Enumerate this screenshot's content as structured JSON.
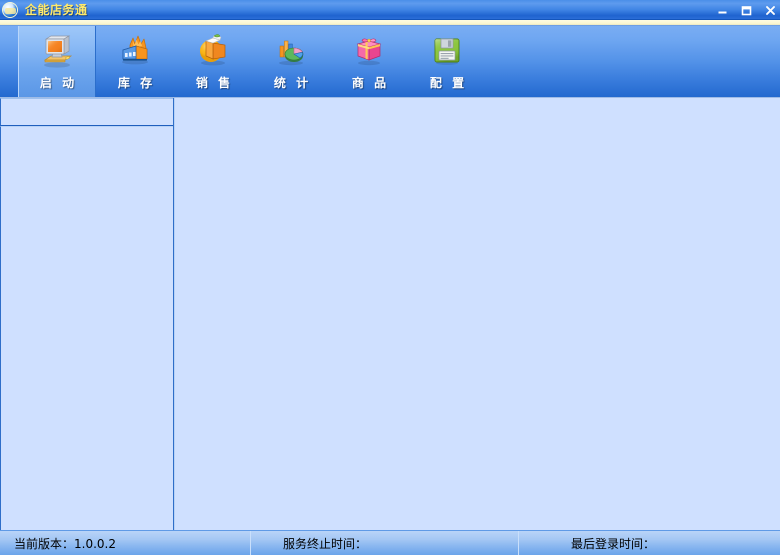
{
  "window": {
    "title": "企能店务通",
    "icon": "app-logo-icon",
    "controls": [
      {
        "name": "minimize",
        "label": "—"
      },
      {
        "name": "maximize",
        "label": "❐"
      },
      {
        "name": "close",
        "label": "✕"
      }
    ]
  },
  "toolbar": {
    "buttons": [
      {
        "label": "启 动",
        "icon": "computer-monitor-icon",
        "active": true
      },
      {
        "label": "库 存",
        "icon": "factory-icon",
        "active": false
      },
      {
        "label": "销 售",
        "icon": "open-box-icon",
        "active": false
      },
      {
        "label": "统 计",
        "icon": "pie-chart-icon",
        "active": false
      },
      {
        "label": "商 品",
        "icon": "gift-box-icon",
        "active": false
      },
      {
        "label": "配 置",
        "icon": "floppy-disk-icon",
        "active": false
      }
    ]
  },
  "sidebar": {
    "top_panel": "",
    "main_panel": ""
  },
  "content": {
    "body": ""
  },
  "statusbar": {
    "version_label": "当前版本：1.0.0.2",
    "service_end_label": "服务终止时间：",
    "last_login_label": "最后登录时间："
  },
  "colors": {
    "titlebar_blue": "#1f63cf",
    "title_text_yellow": "#ffe96a",
    "toolbar_top": "#79adf3",
    "toolbar_bottom": "#2369cf",
    "content_bg": "#cfe0ff",
    "cream_strip": "#fbf8dc",
    "statusbar": "#a4c7f4"
  }
}
